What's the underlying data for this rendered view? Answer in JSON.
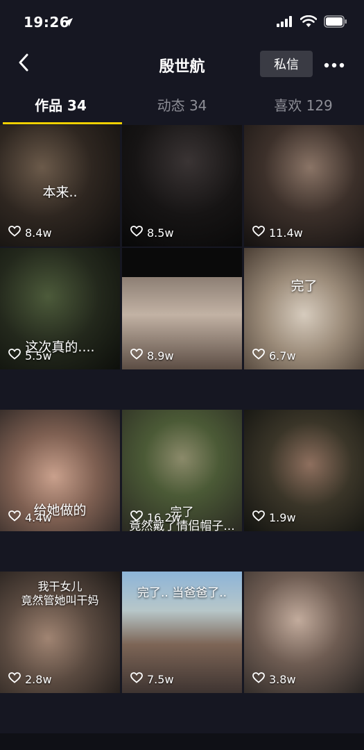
{
  "status_bar": {
    "time": "19:26"
  },
  "nav": {
    "title": "殷世航",
    "message_button": "私信"
  },
  "tabs": [
    {
      "label": "作品 34",
      "active": true
    },
    {
      "label": "动态 34",
      "active": false
    },
    {
      "label": "喜欢 129",
      "active": false
    }
  ],
  "videos": [
    {
      "caption": "本来..",
      "likes": "8.4w"
    },
    {
      "caption": "",
      "likes": "8.5w"
    },
    {
      "caption": "",
      "likes": "11.4w"
    },
    {
      "caption": "这次真的....",
      "likes": "5.5w"
    },
    {
      "caption": "",
      "likes": "8.9w"
    },
    {
      "caption": "完了",
      "likes": "6.7w"
    },
    {
      "caption": "给她做的",
      "likes": "4.4w"
    },
    {
      "caption": "完了\n竟然戴了情侣帽子...",
      "likes": "16.2w"
    },
    {
      "caption": "",
      "likes": "1.9w"
    },
    {
      "caption": "我干女儿\n竟然管她叫干妈",
      "likes": "2.8w"
    },
    {
      "caption": "完了.. 当爸爸了..",
      "likes": "7.5w"
    },
    {
      "caption": "",
      "likes": "3.8w"
    }
  ],
  "colors": {
    "background": "#161722",
    "tab_indicator": "#f5d000",
    "inactive_tab": "#8d8e96"
  }
}
